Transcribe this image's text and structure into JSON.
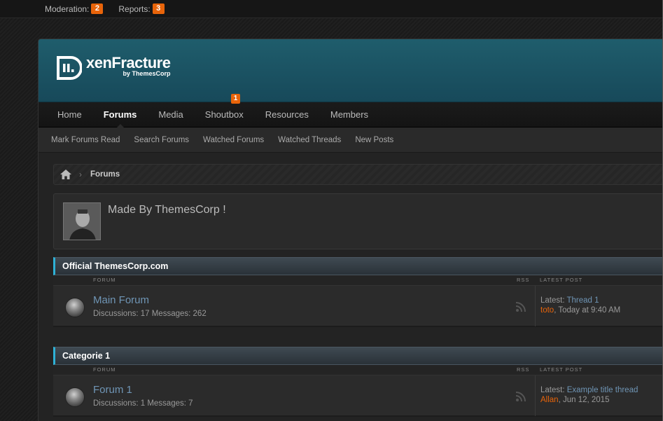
{
  "modbar": {
    "moderation_label": "Moderation:",
    "moderation_count": "2",
    "reports_label": "Reports:",
    "reports_count": "3"
  },
  "header": {
    "logo_title": "xenFracture",
    "logo_sub": "by ThemesCorp"
  },
  "nav": {
    "tabs": [
      {
        "label": "Home"
      },
      {
        "label": "Forums",
        "selected": true
      },
      {
        "label": "Media"
      },
      {
        "label": "Shoutbox",
        "badge": "1"
      },
      {
        "label": "Resources"
      },
      {
        "label": "Members"
      }
    ],
    "sub_links": [
      "Mark Forums Read",
      "Search Forums",
      "Watched Forums",
      "Watched Threads",
      "New Posts"
    ]
  },
  "breadcrumb": {
    "arrow": "›",
    "current": "Forums"
  },
  "notice": {
    "text": "Made By ThemesCorp !"
  },
  "categories": [
    {
      "title": "Official ThemesCorp.com",
      "col_forum": "Forum",
      "col_rss": "RSS",
      "col_latest": "Latest Post",
      "forums": [
        {
          "title": "Main Forum",
          "stats": "Discussions: 17 Messages: 262",
          "latest_prefix": "Latest: ",
          "latest_thread": "Thread 1",
          "latest_user": "toto",
          "latest_date": ", Today at 9:40 AM"
        }
      ]
    },
    {
      "title": "Categorie 1",
      "col_forum": "Forum",
      "col_rss": "RSS",
      "col_latest": "Latest Post",
      "forums": [
        {
          "title": "Forum 1",
          "stats": "Discussions: 1 Messages: 7",
          "latest_prefix": "Latest: ",
          "latest_thread": "Example title thread",
          "latest_user": "Allan",
          "latest_date": ", Jun 12, 2015"
        }
      ]
    }
  ],
  "colors": {
    "accent": "#2eb1d6",
    "badge": "#e8640a",
    "link": "#6f95b5",
    "header": "#1f5d6c"
  }
}
